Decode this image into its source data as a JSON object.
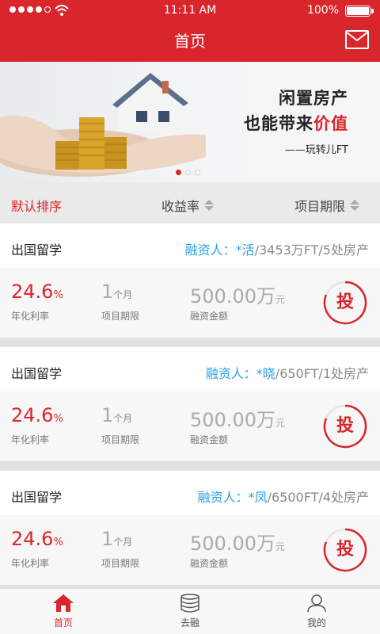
{
  "status_bar": {
    "time": "11:11 AM",
    "battery": "100%"
  },
  "header": {
    "title": "首页",
    "mail_icon": "mail-icon"
  },
  "banner": {
    "line1": "闲置房产",
    "line2_prefix": "也能带来",
    "line2_highlight": "价值",
    "line3": "——玩转儿FT",
    "page_count": 3,
    "active_page": 1
  },
  "sortbar": {
    "default": "默认排序",
    "rate": "收益率",
    "term": "项目期限"
  },
  "cards": [
    {
      "name": "出国留学",
      "info_label": "融资人：",
      "info_person": "*活",
      "info_rest": "/3453万FT/5处房产",
      "rate": "24.6",
      "rate_unit": "%",
      "rate_label": "年化利率",
      "period": "1",
      "period_unit": "个月",
      "period_label": "项目期限",
      "amount": "500.00万",
      "amount_unit": "元",
      "amount_label": "融资金额",
      "invest": "投"
    },
    {
      "name": "出国留学",
      "info_label": "融资人：",
      "info_person": "*晓",
      "info_rest": "/650FT/1处房产",
      "rate": "24.6",
      "rate_unit": "%",
      "rate_label": "年化利率",
      "period": "1",
      "period_unit": "个月",
      "period_label": "项目期限",
      "amount": "500.00万",
      "amount_unit": "元",
      "amount_label": "融资金额",
      "invest": "投"
    },
    {
      "name": "出国留学",
      "info_label": "融资人：",
      "info_person": "*凤",
      "info_rest": "/6500FT/4处房产",
      "rate": "24.6",
      "rate_unit": "%",
      "rate_label": "年化利率",
      "period": "1",
      "period_unit": "个月",
      "period_label": "项目期限",
      "amount": "500.00万",
      "amount_unit": "元",
      "amount_label": "融资金额",
      "invest": "投"
    }
  ],
  "tabbar": {
    "home": "首页",
    "finance": "去融",
    "mine": "我的"
  },
  "colors": {
    "brand": "#d9262c",
    "link": "#2aa1e4"
  }
}
